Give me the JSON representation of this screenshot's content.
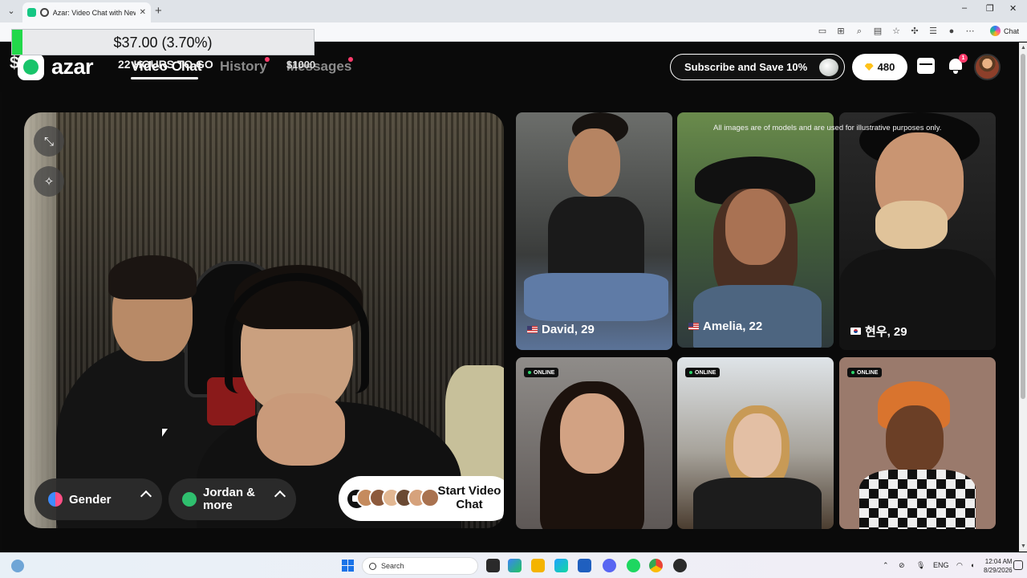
{
  "browser": {
    "tab_title": "Azar: Video Chat with New Pe",
    "tab_close": "✕",
    "new_tab": "+",
    "tab_list": "⌄",
    "window_controls": [
      "–",
      "❐",
      "✕"
    ],
    "toolbar_icons": [
      "camera-icon",
      "apps-icon",
      "zoom-icon",
      "reader-icon",
      "favorite-icon",
      "extensions-icon",
      "favorites-list-icon",
      "profile-icon",
      "more-icon"
    ],
    "copilot_label": "Chat"
  },
  "overlay": {
    "ticker_value": "$37.00 (3.70%)",
    "dollar_sign": "$",
    "hours_text": "22 HOURS TO GO",
    "prize_text": "$1000"
  },
  "header": {
    "logo_text": "azar",
    "nav": {
      "video_chat": "Video Chat",
      "history": "History",
      "messages": "Messages"
    },
    "subscribe_label": "Subscribe and Save 10%",
    "gems_count": "480",
    "notification_count": "1"
  },
  "video": {
    "gender_label": "Gender",
    "location_label": "Jordan & more",
    "start_label": "Start Video Chat"
  },
  "grid": {
    "disclaimer": "All images are of models and are used for illustrative purposes only.",
    "online_label": "ONLINE",
    "profiles": [
      {
        "name": "David, 29",
        "flag": "us"
      },
      {
        "name": "Amelia, 22",
        "flag": "us"
      },
      {
        "name": "현우, 29",
        "flag": "kr"
      }
    ]
  },
  "taskbar": {
    "search_placeholder": "Search",
    "language": "ENG",
    "time": "12:04 AM",
    "date": "8/29/2026"
  },
  "colors": {
    "brand_green": "#18c46a",
    "notification_red": "#ff3b6b",
    "gem_gold": "#ffc21a",
    "ticker_green": "#22d84a"
  }
}
